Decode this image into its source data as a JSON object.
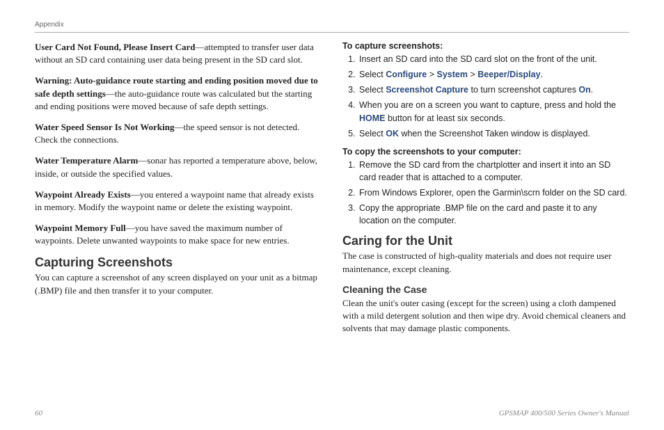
{
  "header": "Appendix",
  "left": {
    "p1": {
      "bold": "User Card Not Found, Please Insert Card",
      "rest": "—attempted to transfer user data without an SD card containing user data being present in the SD card slot."
    },
    "p2": {
      "bold": "Warning: Auto-guidance route starting and ending position moved due to safe depth settings",
      "rest": "—the auto-guidance route was calculated but the starting and ending positions were moved because of safe depth settings."
    },
    "p3": {
      "bold": "Water Speed Sensor Is Not Working",
      "rest": "—the speed sensor is not detected. Check the connections."
    },
    "p4": {
      "bold": "Water Temperature Alarm",
      "rest": "—sonar has reported a temperature above, below, inside, or outside the specified values."
    },
    "p5": {
      "bold": "Waypoint Already Exists",
      "rest": "—you entered a waypoint name that already exists in memory. Modify the waypoint name or delete the existing waypoint."
    },
    "p6": {
      "bold": "Waypoint Memory Full",
      "rest": "—you have saved the maximum number of waypoints. Delete unwanted waypoints to make space for new entries."
    },
    "h2": "Capturing Screenshots",
    "p7": "You can capture a screenshot of any screen displayed on your unit as a bitmap (.BMP) file and then transfer it to your computer."
  },
  "right": {
    "captureTitle": "To capture screenshots:",
    "captureList": {
      "i1": "Insert an SD card into the SD card slot on the front of the unit.",
      "i2_a": "Select ",
      "i2_k1": "Configure",
      "i2_b": " > ",
      "i2_k2": "System",
      "i2_c": " > ",
      "i2_k3": "Beeper/Display",
      "i2_d": ".",
      "i3_a": "Select ",
      "i3_k1": "Screenshot Capture",
      "i3_b": " to turn screenshot captures ",
      "i3_k2": "On",
      "i3_c": ".",
      "i4_a": "When you are on a screen you want to capture, press and hold the ",
      "i4_k1": "HOME",
      "i4_b": " button for at least six seconds.",
      "i5_a": "Select ",
      "i5_k1": "OK",
      "i5_b": " when the Screenshot Taken window is displayed."
    },
    "copyTitle": "To copy the screenshots to your computer:",
    "copyList": {
      "i1": "Remove the SD card from the chartplotter and insert it into an SD card reader that is attached to a computer.",
      "i2": "From Windows Explorer, open the Garmin\\scrn folder on the SD card.",
      "i3": "Copy the appropriate .BMP file on the card and paste it to any location on the computer."
    },
    "h2": "Caring for the Unit",
    "p1": "The case is constructed of high-quality materials and does not require user maintenance, except cleaning.",
    "h3": "Cleaning the Case",
    "p2": "Clean the unit's outer casing (except for the screen) using a cloth dampened with a mild detergent solution and then wipe dry. Avoid chemical cleaners and solvents that may damage plastic components."
  },
  "footer": {
    "page": "60",
    "title": "GPSMAP 400/500 Series Owner's Manual"
  }
}
